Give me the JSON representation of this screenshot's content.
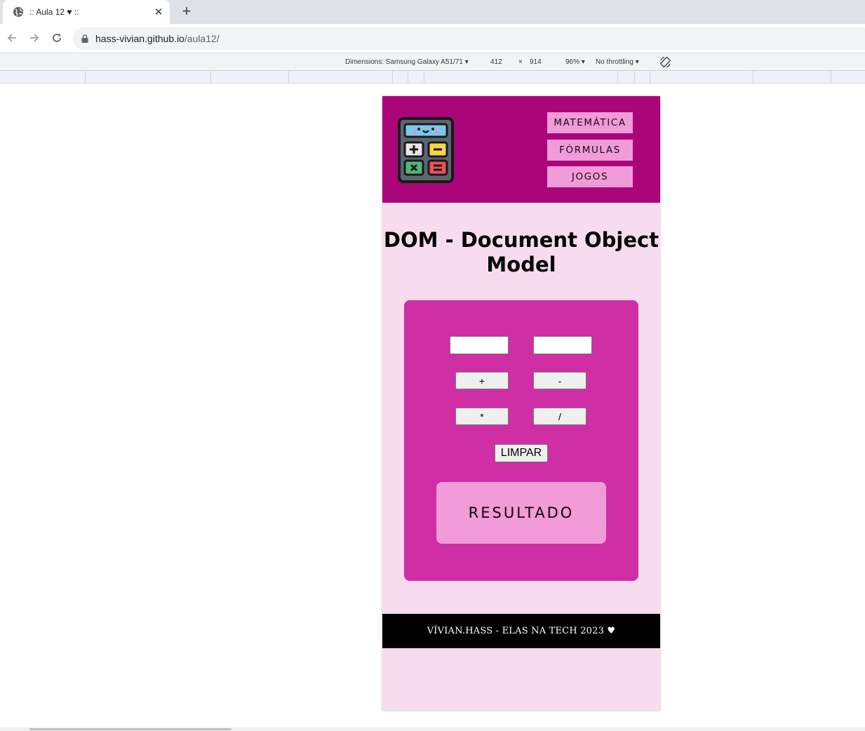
{
  "browser": {
    "tab_title": ":: Aula 12 ♥ ::",
    "close_glyph": "✕",
    "new_tab_glyph": "+",
    "url_host": "hass-vivian.github.io",
    "url_path": "/aula12/"
  },
  "device_toolbar": {
    "dimensions_label": "Dimensions: Samsung Galaxy A51/71",
    "width": "412",
    "times": "×",
    "height": "914",
    "zoom": "96%",
    "throttling": "No throttling"
  },
  "page": {
    "menu": [
      "MATEMÁTICA",
      "FÓRMULAS",
      "JOGOS"
    ],
    "title": "DOM - Document Object Model",
    "calculator": {
      "input1_value": "",
      "input2_value": "",
      "op_plus": "+",
      "op_minus": "-",
      "op_times": "*",
      "op_divide": "/",
      "clear_label": "LIMPAR",
      "result_label": "RESULTADO"
    },
    "footer": "VÍVIAN.HASS - ELAS NA TECH 2023 ♥"
  },
  "colors": {
    "header": "#ab057a",
    "page_bg": "#f6dcee",
    "calc_bg": "#d02ea5",
    "accent_pink": "#f19bd8",
    "footer_bg": "#000000"
  },
  "icons": [
    "globe-icon",
    "back-arrow-icon",
    "forward-arrow-icon",
    "reload-icon",
    "lock-icon",
    "dropdown-caret-icon",
    "rotate-icon",
    "calculator-logo-icon"
  ]
}
